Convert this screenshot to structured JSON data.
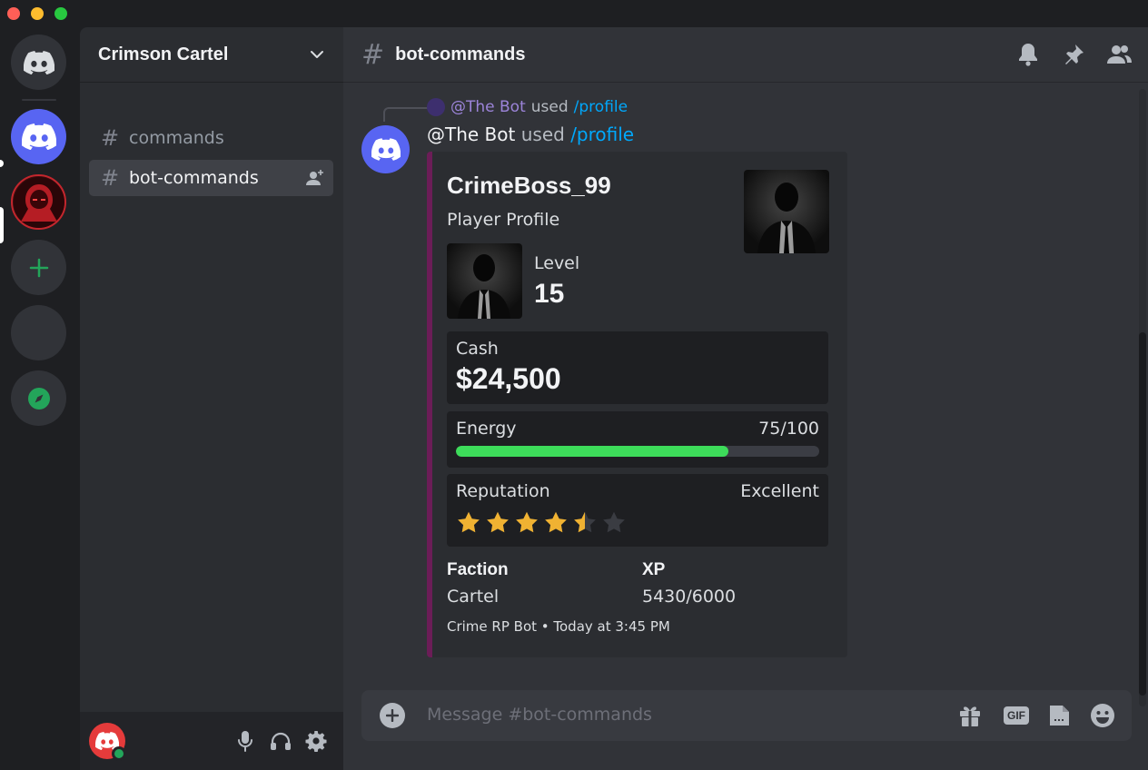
{
  "window": {
    "controls": [
      "close",
      "minimize",
      "zoom"
    ]
  },
  "rail": {
    "servers": [
      {
        "name": "Direct Messages",
        "icon": "discord-icon"
      },
      {
        "name": "Discord server",
        "icon": "discord-icon"
      },
      {
        "name": "Crimson Cartel",
        "icon": "hooded-figure-icon"
      },
      {
        "name": "Add a Server",
        "icon": "plus-icon"
      },
      {
        "name": "",
        "icon": ""
      },
      {
        "name": "Explore",
        "icon": "compass-icon"
      }
    ]
  },
  "sidebar": {
    "guild_name": "Crimson Cartel",
    "channels": [
      {
        "hash": "#",
        "label": "commands"
      },
      {
        "hash": "#",
        "label": "bot-commands"
      }
    ]
  },
  "header": {
    "hash": "#",
    "channel": "bot-commands"
  },
  "message": {
    "reply_author": "@The Bot",
    "reply_used": "used",
    "reply_command": "/profile",
    "author": "@The Bot",
    "used": "used",
    "command": "/profile"
  },
  "embed": {
    "accent_color": "#6b1d57",
    "title": "CrimeBoss_99",
    "subtitle": "Player Profile",
    "level_label": "Level",
    "level_value": "15",
    "cash_label": "Cash",
    "cash_value": "$24,500",
    "energy_label": "Energy",
    "energy_value": "75/100",
    "energy_fraction": 0.75,
    "reputation_label": "Reputation",
    "reputation_value": "Excellent",
    "reputation_stars": 4.5,
    "reputation_max": 6,
    "fields": [
      {
        "name": "Faction",
        "value": "Cartel"
      },
      {
        "name": "XP",
        "value": "5430/6000"
      }
    ],
    "footer": "Crime RP Bot • Today at 3:45 PM"
  },
  "composer": {
    "placeholder": "Message #bot-commands",
    "gif_label": "GIF"
  },
  "colors": {
    "brand": "#5865f2",
    "energy_bar": "#3ddc5a",
    "star": "#f0b232",
    "online": "#23a55a"
  }
}
